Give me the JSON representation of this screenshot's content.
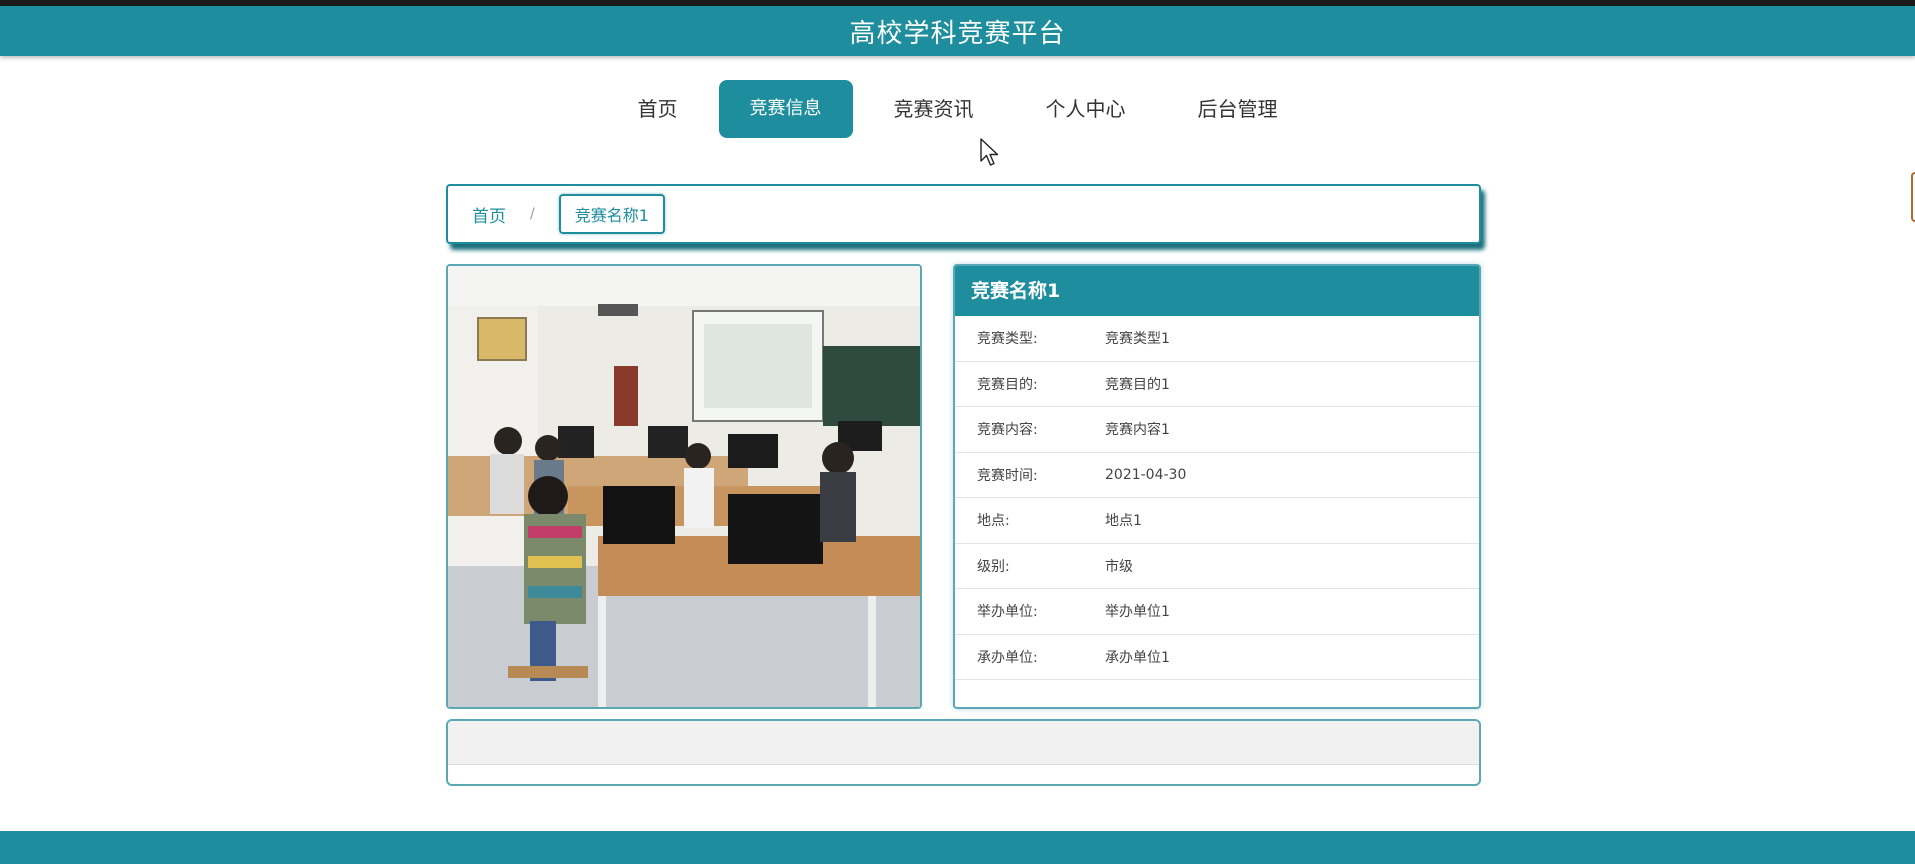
{
  "header": {
    "title": "高校学科竞赛平台"
  },
  "nav": {
    "items": [
      {
        "label": "首页"
      },
      {
        "label": "竞赛信息",
        "active": true
      },
      {
        "label": "竞赛资讯"
      },
      {
        "label": "个人中心"
      },
      {
        "label": "后台管理"
      }
    ]
  },
  "breadcrumb": {
    "home": "首页",
    "separator": "/",
    "current": "竞赛名称1"
  },
  "detail": {
    "title": "竞赛名称1",
    "rows": [
      {
        "label": "竞赛类型:",
        "value": "竞赛类型1"
      },
      {
        "label": "竞赛目的:",
        "value": "竞赛目的1"
      },
      {
        "label": "竞赛内容:",
        "value": "竞赛内容1"
      },
      {
        "label": "竞赛时间:",
        "value": "2021-04-30"
      },
      {
        "label": "地点:",
        "value": "地点1"
      },
      {
        "label": "级别:",
        "value": "市级"
      },
      {
        "label": "举办单位:",
        "value": "举办单位1"
      },
      {
        "label": "承办单位:",
        "value": "承办单位1"
      }
    ]
  },
  "colors": {
    "primary": "#1e8e9e",
    "border": "#5aa8b4"
  },
  "icons": {
    "cursor": "mouse-cursor-icon"
  }
}
